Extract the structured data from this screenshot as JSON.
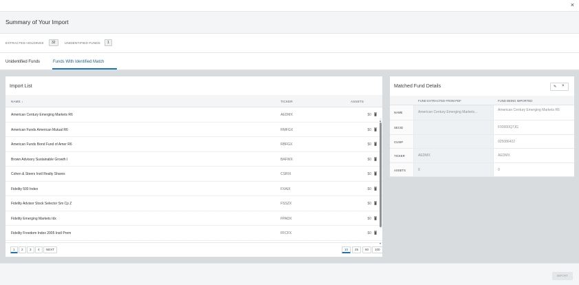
{
  "window": {
    "close_symbol": "×"
  },
  "title": "Summary of Your Import",
  "stats": {
    "extracted_label": "EXTRACTED HOLDINGS",
    "extracted_count": "32",
    "unidentified_label": "UNIDENTIFIED FUNDS",
    "unidentified_count": "1"
  },
  "tabs": [
    {
      "label": "Unidentified Funds"
    },
    {
      "label": "Funds With Identified Match",
      "active": true
    }
  ],
  "import_list": {
    "title": "Import List",
    "columns": {
      "name": "NAME ↓",
      "ticker": "TICKER",
      "assets": "ASSETS"
    },
    "rows": [
      {
        "name": "American Century Emerging Markets R6",
        "ticker": "AEDMX",
        "assets": "$0"
      },
      {
        "name": "American Funds American Mutual R6",
        "ticker": "RMFGX",
        "assets": "$0"
      },
      {
        "name": "American Funds Bond Fund of Amer R6",
        "ticker": "RBFGX",
        "assets": "$0"
      },
      {
        "name": "Brown Advisory Sustainable Growth I",
        "ticker": "BAFWX",
        "assets": "$0"
      },
      {
        "name": "Cohen & Steers Instl Realty Shares",
        "ticker": "CSRIX",
        "assets": "$0"
      },
      {
        "name": "Fidelity 500 Index",
        "ticker": "FXAIX",
        "assets": "$0"
      },
      {
        "name": "Fidelity Advisor Stock Selector Sm Cp Z",
        "ticker": "FSSZX",
        "assets": "$0"
      },
      {
        "name": "Fidelity Emerging Markets Idx",
        "ticker": "FPADX",
        "assets": "$0"
      },
      {
        "name": "Fidelity Freedom Index 2005 Instl Prem",
        "ticker": "FFCFX",
        "assets": "$0"
      }
    ],
    "pages": [
      "1",
      "2",
      "3",
      "4",
      "NEXT"
    ],
    "page_sizes": [
      "10",
      "25",
      "50",
      "100"
    ]
  },
  "matched": {
    "title": "Matched Fund Details",
    "edit_symbol": "✎",
    "close_symbol": "×",
    "col_pdf": "FUND EXTRACTED FROM PDF",
    "col_imported": "FUND BEING IMPORTED",
    "rows": [
      {
        "label": "NAME",
        "pdf": "American Century Emerging Markets...",
        "imported": "American Century Emerging Markets R6"
      },
      {
        "label": "SECID",
        "pdf": "",
        "imported": "F00000Q7JG"
      },
      {
        "label": "CUSIP",
        "pdf": "",
        "imported": "025086422"
      },
      {
        "label": "TICKER",
        "pdf": "AEDMX",
        "imported": "AEDMX"
      },
      {
        "label": "ASSETS",
        "pdf": "0",
        "imported": "0"
      }
    ]
  },
  "footer": {
    "import_label": "IMPORT"
  }
}
